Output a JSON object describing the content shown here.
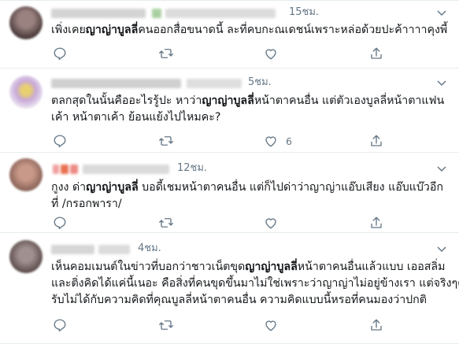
{
  "tweets": [
    {
      "time": "15ชม.",
      "lines": [
        {
          "before": "เพิ่งเคย",
          "bold": "ญาญ่าบูลลี่",
          "after": "คนออกสื่อขนาดนี้ ละที่คบกะณเดชน์เพราะหล่อด้วยปะค้าาาาคุงพี้"
        }
      ],
      "actions": {
        "reply": "",
        "retweet": "",
        "like": "",
        "share": ""
      },
      "avatar_color": "#6e5a58"
    },
    {
      "time": "5ชม.",
      "lines": [
        {
          "before": "ตลกสุดในนั้นคืออะไรรู้ปะ หาว่า",
          "bold": "ญาญ่าบูลลี่",
          "after": "หน้าตาคนอื่น แต่ตัวเองบูลลี่หน้าตาแฟน"
        },
        {
          "before": "เค้า หน้าตาเค้า ย้อนแย้งไปไหมคะ?",
          "bold": "",
          "after": ""
        }
      ],
      "actions": {
        "reply": "",
        "retweet": "",
        "like": "6",
        "share": ""
      },
      "avatar_color": "#c9b7d8"
    },
    {
      "time": "12ชม.",
      "lines": [
        {
          "before": "กูงง ด่า",
          "bold": "ญาญ่าบูลลี่",
          "after": " บอดี้เชมหน้าตาคนอื่น แต่ก็ไปด่าว่าญาญ่าแอ๊บเสียง แอ๊บแบ๊วอีก"
        },
        {
          "before": "ที่ /กรอกพารา/",
          "bold": "",
          "after": ""
        }
      ],
      "actions": {
        "reply": "",
        "retweet": "",
        "like": "",
        "share": ""
      },
      "avatar_color": "#b48a78"
    },
    {
      "time": "4ชม.",
      "lines": [
        {
          "before": "เห็นคอมเมนต์ในข่าวที่บอกว่าชาวเน็ตขุด",
          "bold": "ญาญ่าบูลลี่",
          "after": "หน้าตาคนอื่นแล้วแบบ เออสลิ่ม"
        },
        {
          "before": "และติ่งคิดได้แค่นี้เนอะ คือสิ่งที่คนขุดขึ้นมาไม่ใช่เพราะว่าญาญ่าไม่อยู่ข้างเรา แต่จริงๆคือ",
          "bold": "",
          "after": ""
        },
        {
          "before": "รับไม่ได้กับความคิดที่คุณบูลลี่หน้าตาคนอื่น ความคิดแบบนี้หรอที่คนมองว่าปกติ",
          "bold": "",
          "after": ""
        }
      ],
      "actions": {
        "reply": "",
        "retweet": "",
        "like": "",
        "share": ""
      },
      "avatar_color": "#7a6a66"
    }
  ],
  "colors": {
    "text": "#14171a",
    "muted": "#657786",
    "border": "#e6ecf0"
  }
}
